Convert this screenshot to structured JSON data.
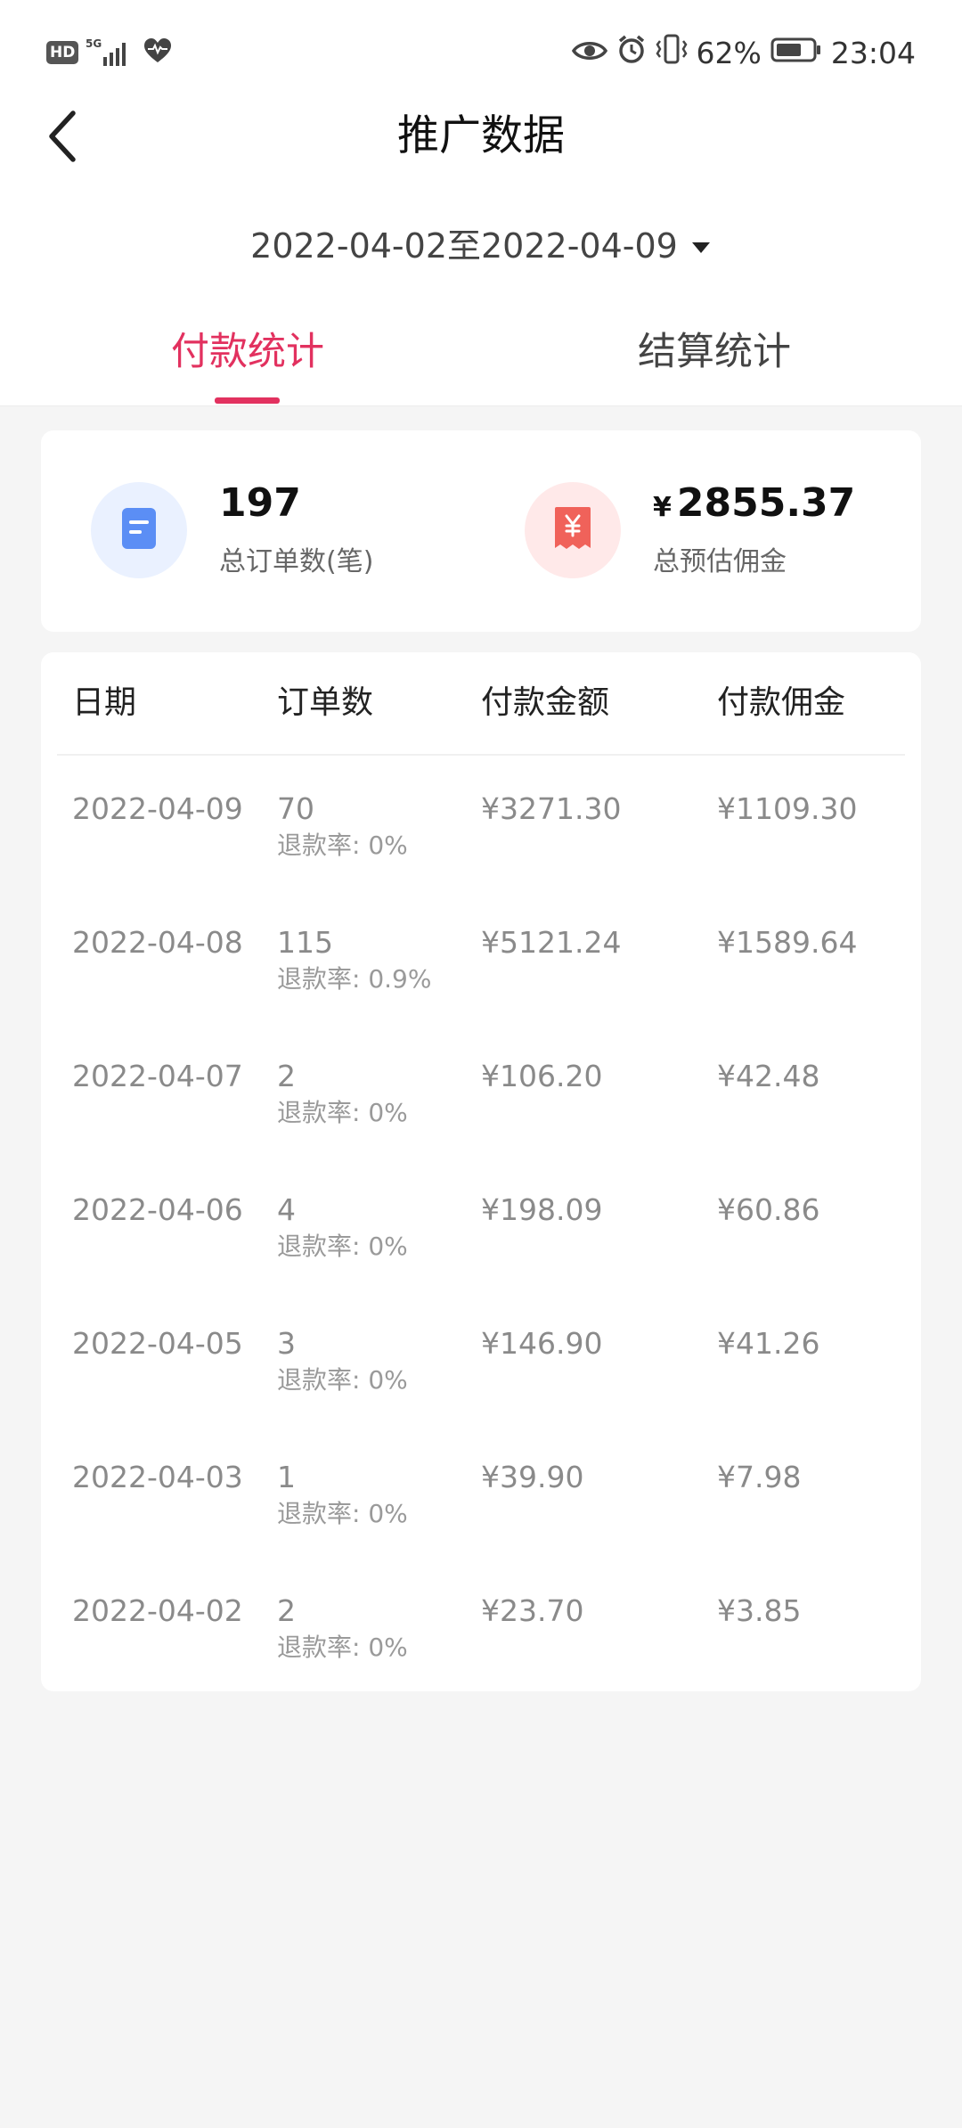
{
  "status_bar": {
    "hd": "HD",
    "network": "5G",
    "battery": "62%",
    "time": "23:04"
  },
  "header": {
    "title": "推广数据",
    "back_icon": "chevron-left-icon"
  },
  "date_range": {
    "label": "2022-04-02至2022-04-09",
    "dropdown_icon": "caret-down-icon"
  },
  "tabs": [
    {
      "label": "付款统计",
      "active": true
    },
    {
      "label": "结算统计",
      "active": false
    }
  ],
  "summary": {
    "orders": {
      "value": "197",
      "label": "总订单数(笔)",
      "icon": "document-icon"
    },
    "commission": {
      "currency": "¥",
      "value": "2855.37",
      "label": "总预估佣金",
      "icon": "receipt-yen-icon"
    }
  },
  "table": {
    "headers": [
      "日期",
      "订单数",
      "付款金额",
      "付款佣金"
    ],
    "rows": [
      {
        "date": "2022-04-09",
        "orders": "70",
        "refund": "退款率: 0%",
        "amount": "¥3271.30",
        "commission": "¥1109.30"
      },
      {
        "date": "2022-04-08",
        "orders": "115",
        "refund": "退款率: 0.9%",
        "amount": "¥5121.24",
        "commission": "¥1589.64"
      },
      {
        "date": "2022-04-07",
        "orders": "2",
        "refund": "退款率: 0%",
        "amount": "¥106.20",
        "commission": "¥42.48"
      },
      {
        "date": "2022-04-06",
        "orders": "4",
        "refund": "退款率: 0%",
        "amount": "¥198.09",
        "commission": "¥60.86"
      },
      {
        "date": "2022-04-05",
        "orders": "3",
        "refund": "退款率: 0%",
        "amount": "¥146.90",
        "commission": "¥41.26"
      },
      {
        "date": "2022-04-03",
        "orders": "1",
        "refund": "退款率: 0%",
        "amount": "¥39.90",
        "commission": "¥7.98"
      },
      {
        "date": "2022-04-02",
        "orders": "2",
        "refund": "退款率: 0%",
        "amount": "¥23.70",
        "commission": "¥3.85"
      }
    ]
  },
  "colors": {
    "accent": "#e2315f",
    "blue_icon": "#5b8ef5",
    "red_icon": "#f0625a"
  }
}
